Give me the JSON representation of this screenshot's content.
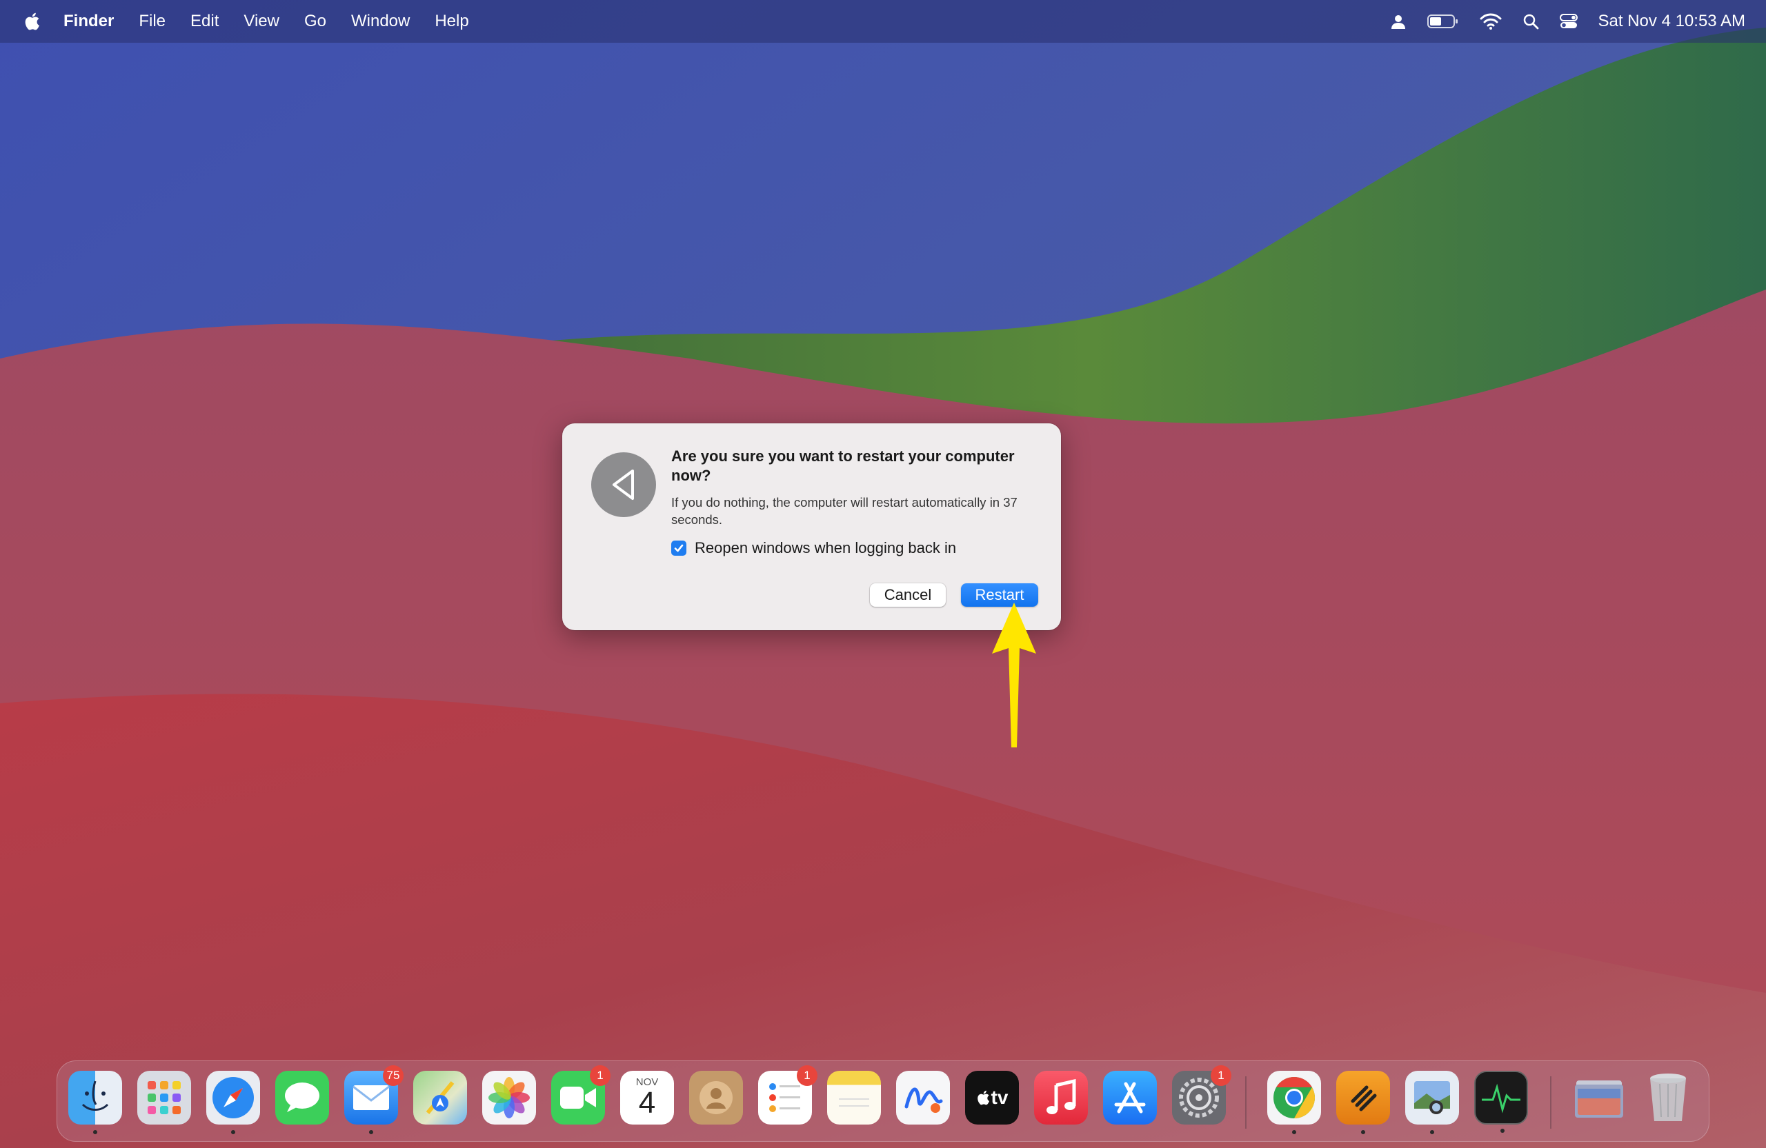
{
  "menubar": {
    "apple_icon": "apple-logo-icon",
    "items": [
      "Finder",
      "File",
      "Edit",
      "View",
      "Go",
      "Window",
      "Help"
    ],
    "status_icons": [
      "user-icon",
      "battery-icon",
      "wifi-icon",
      "search-icon",
      "control-center-icon"
    ],
    "clock": "Sat Nov 4  10:53 AM"
  },
  "dialog": {
    "icon": "restart-arrow-icon",
    "title": "Are you sure you want to restart your computer now?",
    "message": "If you do nothing, the computer will restart automatically in 37 seconds.",
    "checkbox_label": "Reopen windows when logging back in",
    "checkbox_checked": true,
    "cancel_label": "Cancel",
    "restart_label": "Restart"
  },
  "colors": {
    "accent": "#1f7df0",
    "annotation_arrow": "#ffe600",
    "badge": "#e8453c"
  },
  "dock": {
    "apps": [
      {
        "name": "Finder",
        "icon": "finder-icon",
        "running": true
      },
      {
        "name": "Launchpad",
        "icon": "launchpad-icon",
        "running": false
      },
      {
        "name": "Safari",
        "icon": "safari-icon",
        "running": true
      },
      {
        "name": "Messages",
        "icon": "messages-icon",
        "running": false
      },
      {
        "name": "Mail",
        "icon": "mail-icon",
        "running": true,
        "badge": "75"
      },
      {
        "name": "Maps",
        "icon": "maps-icon",
        "running": false
      },
      {
        "name": "Photos",
        "icon": "photos-icon",
        "running": false
      },
      {
        "name": "FaceTime",
        "icon": "facetime-icon",
        "running": false,
        "badge": "1"
      },
      {
        "name": "Calendar",
        "icon": "calendar-icon",
        "running": false,
        "month": "NOV",
        "day": "4"
      },
      {
        "name": "Contacts",
        "icon": "contacts-icon",
        "running": false
      },
      {
        "name": "Reminders",
        "icon": "reminders-icon",
        "running": false,
        "badge": "1"
      },
      {
        "name": "Notes",
        "icon": "notes-icon",
        "running": false
      },
      {
        "name": "Freeform",
        "icon": "freeform-icon",
        "running": false
      },
      {
        "name": "TV",
        "icon": "tv-icon",
        "running": false,
        "label": "tv"
      },
      {
        "name": "Music",
        "icon": "music-icon",
        "running": false
      },
      {
        "name": "App Store",
        "icon": "app-store-icon",
        "running": false
      },
      {
        "name": "System Settings",
        "icon": "system-settings-icon",
        "running": false,
        "badge": "1"
      },
      {
        "name": "Chrome",
        "icon": "chrome-icon",
        "running": true
      },
      {
        "name": "Toolbox",
        "icon": "toolbox-icon",
        "running": true
      },
      {
        "name": "Preview",
        "icon": "preview-icon",
        "running": true
      },
      {
        "name": "Activity Monitor",
        "icon": "activity-monitor-icon",
        "running": true
      },
      {
        "name": "Downloads",
        "icon": "downloads-stack-icon",
        "running": false
      },
      {
        "name": "Trash",
        "icon": "trash-icon",
        "running": false
      }
    ]
  }
}
